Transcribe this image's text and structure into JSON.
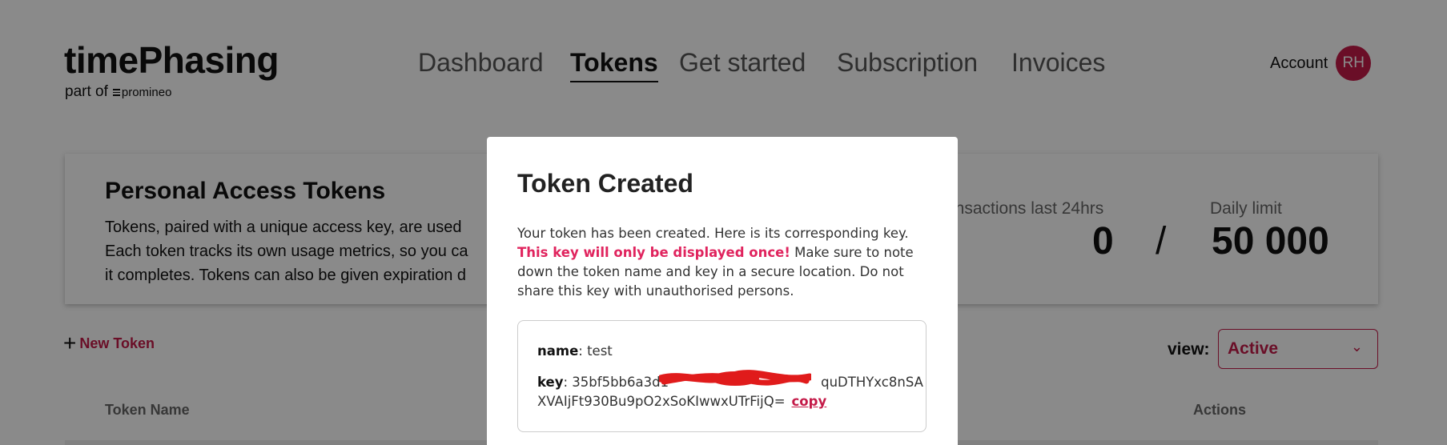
{
  "header": {
    "logo_title": "timePhasing",
    "logo_sub_prefix": "part of",
    "logo_sub_brand": "promineo",
    "nav": [
      "Dashboard",
      "Tokens",
      "Get started",
      "Subscription",
      "Invoices"
    ],
    "active_nav": "Tokens",
    "account_label": "Account",
    "avatar_initials": "RH"
  },
  "card": {
    "title": "Personal Access Tokens",
    "desc_lines": [
      "Tokens, paired with a unique access key, are used",
      "Each token tracks its own usage metrics, so you ca",
      "it completes. Tokens can also be given expiration d"
    ],
    "stats": {
      "transactions_label": "ansactions last 24hrs",
      "transactions_value": "0",
      "separator": "/",
      "limit_label": "Daily limit",
      "limit_value": "50 000"
    }
  },
  "toolbar": {
    "new_token_label": "New Token",
    "view_label": "view:",
    "view_value": "Active"
  },
  "table": {
    "headers": {
      "name": "Token Name",
      "actions": "Actions"
    }
  },
  "modal": {
    "title": "Token Created",
    "body_intro": "Your token has been created. Here is its corresponding key.",
    "body_warning": "This key will only be displayed once!",
    "body_rest": "Make sure to note down the token name and key in a secure location. Do not share this key with unauthorised persons.",
    "name_label": "name",
    "name_value": "test",
    "key_label": "key",
    "key_line1_start": "35bf5bb6a3d1",
    "key_line1_end": "quDTHYxc8nSA",
    "key_line2": "XVAIjFt930Bu9pO2xSoKIwwxUTrFijQ=",
    "copy_label": "copy"
  },
  "colors": {
    "accent": "#c41a48",
    "warning": "#e0245e",
    "overlay": "rgba(0,0,0,0.46)",
    "redaction": "#e01b1b"
  }
}
